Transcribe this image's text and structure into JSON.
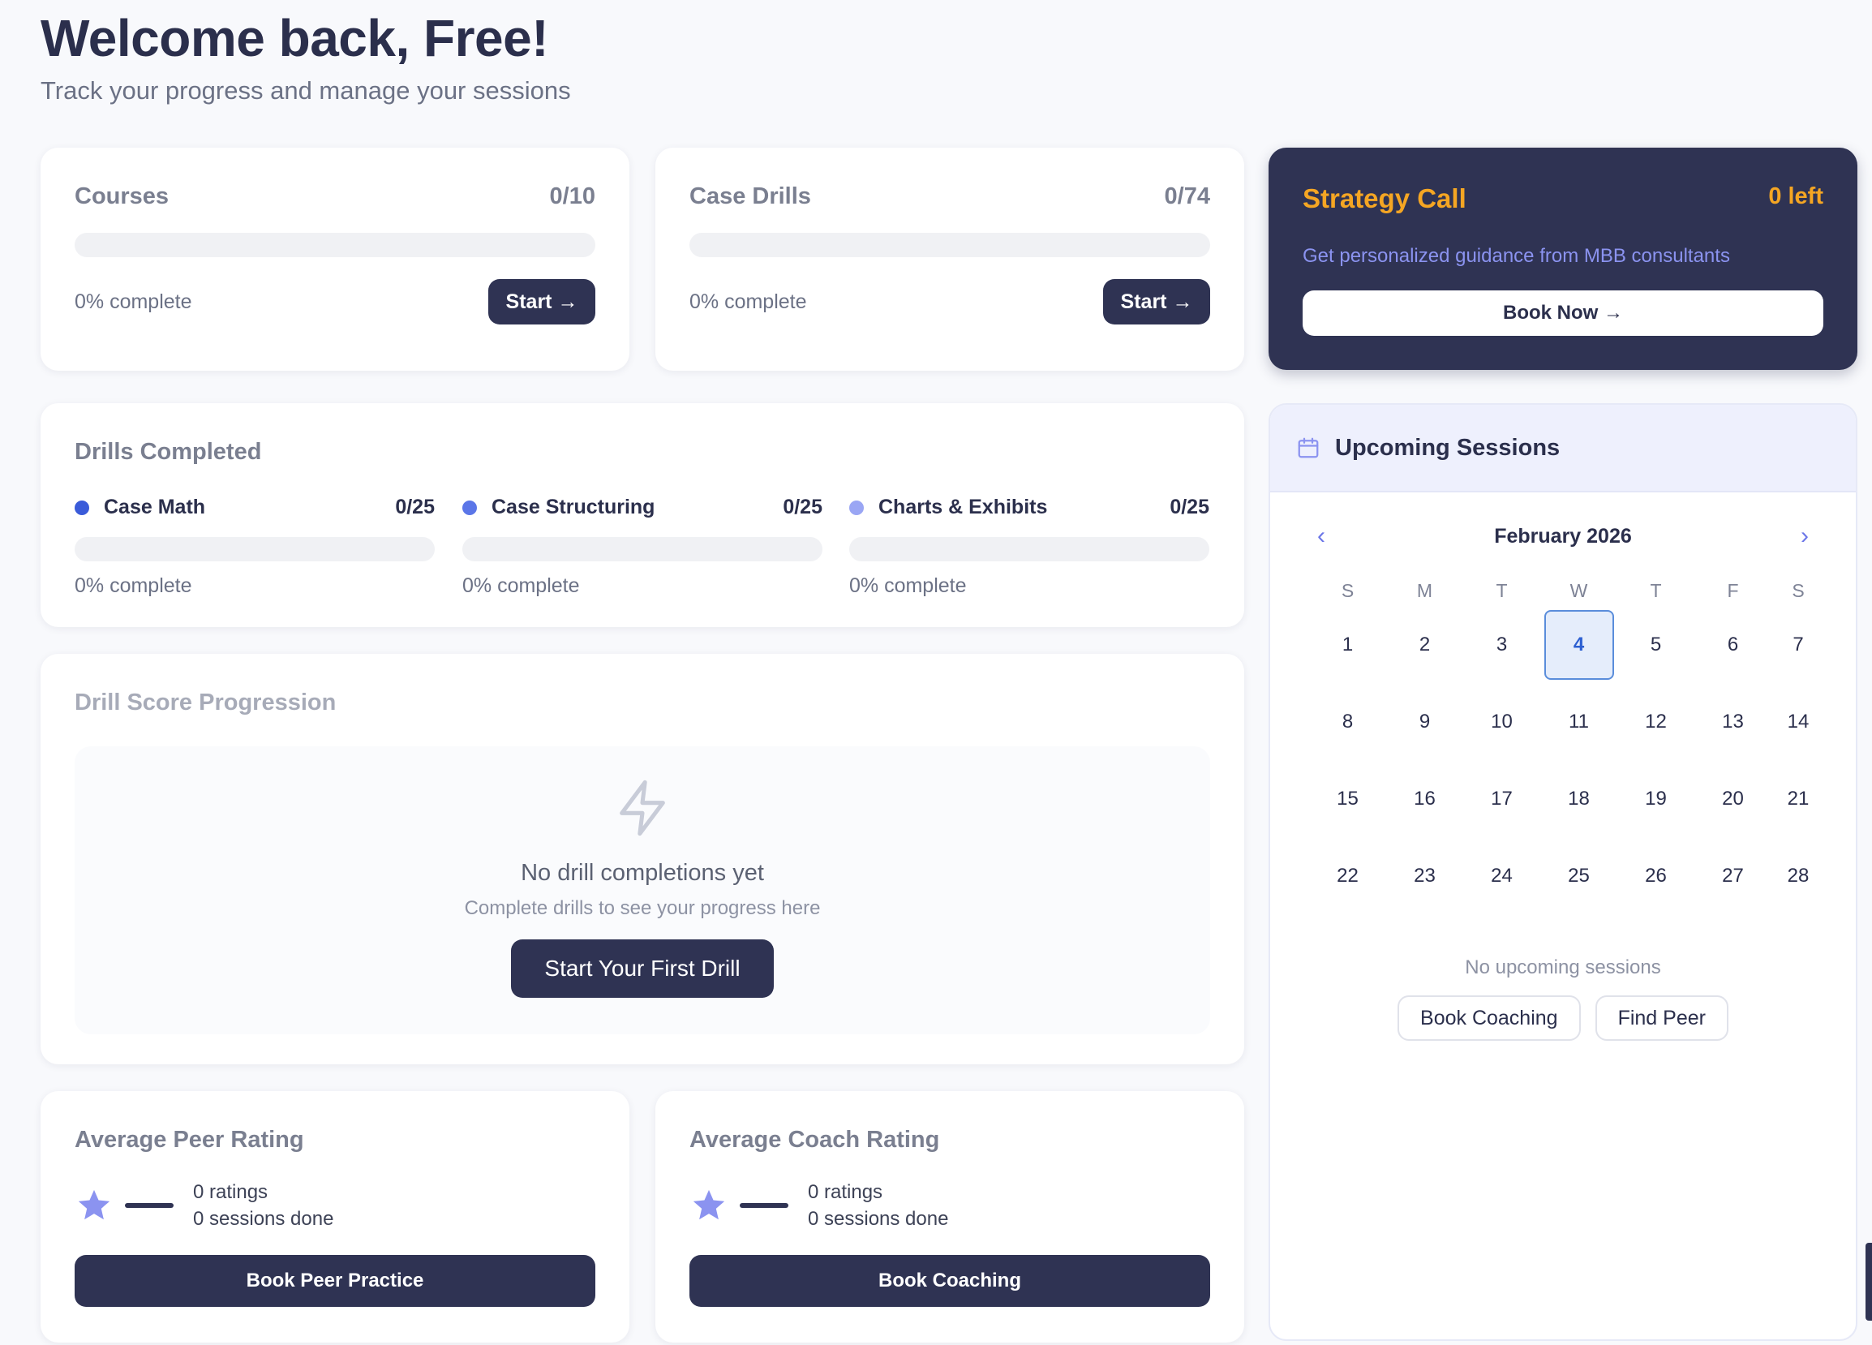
{
  "header": {
    "title": "Welcome back, Free!",
    "subtitle": "Track your progress and manage your sessions"
  },
  "courses": {
    "title": "Courses",
    "count": "0/10",
    "progress": 0,
    "percent_label": "0% complete",
    "button": "Start →"
  },
  "case_drills": {
    "title": "Case Drills",
    "count": "0/74",
    "progress": 0,
    "percent_label": "0% complete",
    "button": "Start →"
  },
  "strategy_call": {
    "title": "Strategy Call",
    "remaining": "0 left",
    "subtitle": "Get personalized guidance from MBB consultants",
    "button": "Book Now →",
    "title_color": "#f5a623",
    "bg_color": "#2f3353"
  },
  "drills_completed": {
    "title": "Drills Completed",
    "items": [
      {
        "label": "Case Math",
        "count": "0/25",
        "percent_label": "0% complete",
        "progress": 0,
        "dot_color": "#3a5bd9"
      },
      {
        "label": "Case Structuring",
        "count": "0/25",
        "percent_label": "0% complete",
        "progress": 0,
        "dot_color": "#5b76e8"
      },
      {
        "label": "Charts & Exhibits",
        "count": "0/25",
        "percent_label": "0% complete",
        "progress": 0,
        "dot_color": "#9aa6f4"
      }
    ]
  },
  "progression": {
    "title": "Drill Score Progression",
    "icon": "lightning-icon",
    "empty_title": "No drill completions yet",
    "empty_subtitle": "Complete drills to see your progress here",
    "button": "Start Your First Drill"
  },
  "peer_rating": {
    "title": "Average Peer Rating",
    "ratings": "0 ratings",
    "sessions": "0 sessions done",
    "button": "Book Peer Practice"
  },
  "coach_rating": {
    "title": "Average Coach Rating",
    "ratings": "0 ratings",
    "sessions": "0 sessions done",
    "button": "Book Coaching"
  },
  "sessions": {
    "title": "Upcoming Sessions",
    "icon": "calendar-icon",
    "month": "February 2026",
    "weekdays": [
      "S",
      "M",
      "T",
      "W",
      "T",
      "F",
      "S"
    ],
    "weeks": [
      [
        "1",
        "2",
        "3",
        "4",
        "5",
        "6",
        "7"
      ],
      [
        "8",
        "9",
        "10",
        "11",
        "12",
        "13",
        "14"
      ],
      [
        "15",
        "16",
        "17",
        "18",
        "19",
        "20",
        "21"
      ],
      [
        "22",
        "23",
        "24",
        "25",
        "26",
        "27",
        "28"
      ]
    ],
    "today": "4",
    "empty": "No upcoming sessions",
    "book_button": "Book Coaching",
    "peer_button": "Find Peer"
  },
  "colors": {
    "primary": "#2f3353",
    "accent": "#f5a623",
    "star": "#8b93f0",
    "today_border": "#5a8ddb"
  }
}
